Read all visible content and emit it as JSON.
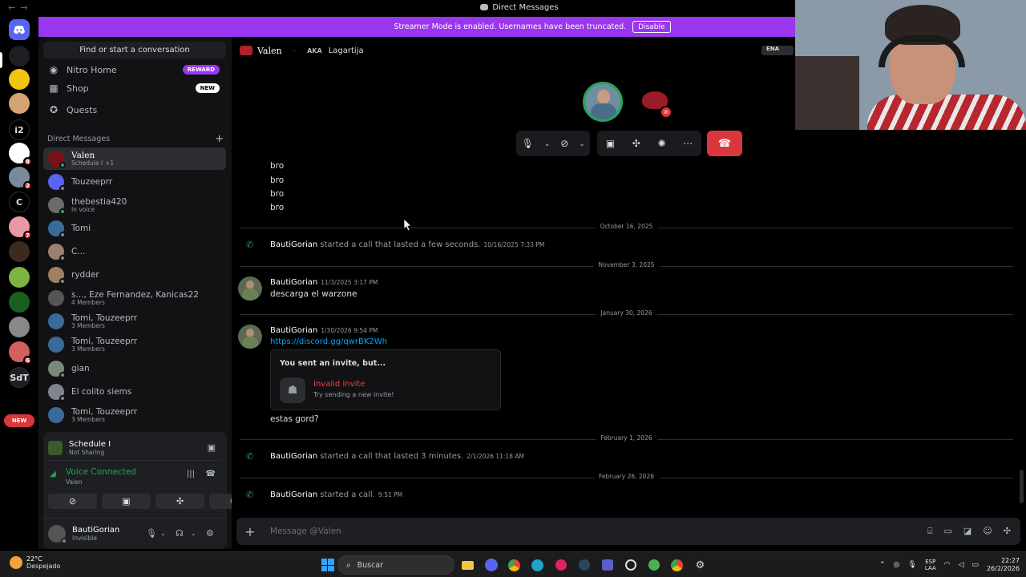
{
  "window": {
    "title": "Direct Messages"
  },
  "banner": {
    "text": "Streamer Mode is enabled. Usernames have been truncated.",
    "disable_label": "Disable"
  },
  "servers": [
    {
      "label": "",
      "color": "#5865f2"
    },
    {
      "label": "",
      "color": "#1e1f22"
    },
    {
      "label": "",
      "color": "#f1c40f"
    },
    {
      "label": "",
      "color": "#d4a373"
    },
    {
      "label": "i2",
      "color": "#000000"
    },
    {
      "label": "",
      "color": "#ffffff",
      "badge": "8"
    },
    {
      "label": "",
      "color": "#7a8a9a",
      "badge": "2"
    },
    {
      "label": "C",
      "color": "#000000"
    },
    {
      "label": "",
      "color": "#e89aa3",
      "badge": "7"
    },
    {
      "label": "",
      "color": "#3b2a1e",
      "badge": ""
    },
    {
      "label": "",
      "color": "#7cb342"
    },
    {
      "label": "",
      "color": "#1b5e20"
    },
    {
      "label": "",
      "color": "#888888"
    },
    {
      "label": "",
      "color": "#d35f5f",
      "badge": "6"
    },
    {
      "label": "SdT",
      "color": "#1e1f22"
    }
  ],
  "rail_new_label": "NEW",
  "sidebar": {
    "search": "Find or start a conversation",
    "nav": [
      {
        "label": "Nitro Home",
        "tag": "REWARD",
        "tag_color": "#9b36f0",
        "icon": "nitro-icon"
      },
      {
        "label": "Shop",
        "tag": "NEW",
        "tag_color": "#ffffff",
        "icon": "shop-icon"
      },
      {
        "label": "Quests",
        "tag": "",
        "icon": "quests-icon"
      }
    ],
    "dm_header": "Direct Messages",
    "dms": [
      {
        "name": "Valen",
        "sub": "Schedule I",
        "sub_extra": "+1",
        "color": "#7a1018",
        "status": "#23a55a",
        "active": true
      },
      {
        "name": "Touzeeprr",
        "sub": "",
        "color": "#5865f2",
        "status": "#80848e"
      },
      {
        "name": "thebestia420",
        "sub": "In voice",
        "color": "#6b6b6b",
        "status": "#23a55a"
      },
      {
        "name": "Tomi",
        "sub": "",
        "color": "#3a6a9a",
        "status": "#80848e"
      },
      {
        "name": "C...",
        "sub": "",
        "color": "#9a8070",
        "status": "#80848e"
      },
      {
        "name": "rydder",
        "sub": "",
        "color": "#a08060",
        "status": "#80848e"
      },
      {
        "name": "s..., Eze Fernandez, Kanicas22",
        "sub": "4 Members",
        "color": "#555555",
        "status": ""
      },
      {
        "name": "Tomi, Touzeeprr",
        "sub": "3 Members",
        "color": "#3a6a9a",
        "status": ""
      },
      {
        "name": "Tomi, Touzeeprr",
        "sub": "3 Members",
        "color": "#3a6a9a",
        "status": ""
      },
      {
        "name": "gian",
        "sub": "",
        "color": "#7a8a7a",
        "status": "#80848e"
      },
      {
        "name": "El colito siems",
        "sub": "",
        "color": "#80848e",
        "status": "#80848e"
      },
      {
        "name": "Tomi, Touzeeprr",
        "sub": "3 Members",
        "color": "#3a6a9a",
        "status": ""
      }
    ]
  },
  "panel": {
    "activity_title": "Schedule I",
    "activity_sub": "Not Sharing",
    "voice_title": "Voice Connected",
    "voice_sub": "Valen",
    "user_name": "BautiGorian",
    "user_status": "Invisible"
  },
  "channel": {
    "name": "Valen",
    "aka": "AKA",
    "nickname": "Lagartija",
    "badge": "ENA"
  },
  "messages": {
    "bro_lines": [
      "bro",
      "bro",
      "bro",
      "bro"
    ],
    "dates": [
      "October 16, 2025",
      "November 3, 2025",
      "January 30, 2026",
      "February 1, 2026",
      "February 26, 2026"
    ],
    "call1": {
      "author": "BautiGorian",
      "text": "started a call that lasted a few seconds.",
      "time": "10/16/2025 7:33 PM"
    },
    "msg1": {
      "author": "BautiGorian",
      "time": "11/3/2025 3:17 PM",
      "text": "descarga el warzone"
    },
    "msg2": {
      "author": "BautiGorian",
      "time": "1/30/2026 9:54 PM",
      "link": "https://discord.gg/qwrBK2Wh",
      "after": "estas gord?"
    },
    "invite": {
      "heading": "You sent an invite, but...",
      "title": "Invalid Invite",
      "sub": "Try sending a new invite!"
    },
    "call2": {
      "author": "BautiGorian",
      "text": "started a call that lasted 3 minutes.",
      "time": "2/1/2026 11:18 AM"
    },
    "call3": {
      "author": "BautiGorian",
      "text": "started a call.",
      "time": "9:51 PM"
    }
  },
  "composer": {
    "placeholder": "Message @Valen"
  },
  "taskbar": {
    "temp": "22°C",
    "weather": "Despejado",
    "search": "Buscar",
    "lang1": "ESP",
    "lang2": "LAA",
    "time": "22:27",
    "date": "26/2/2026"
  }
}
